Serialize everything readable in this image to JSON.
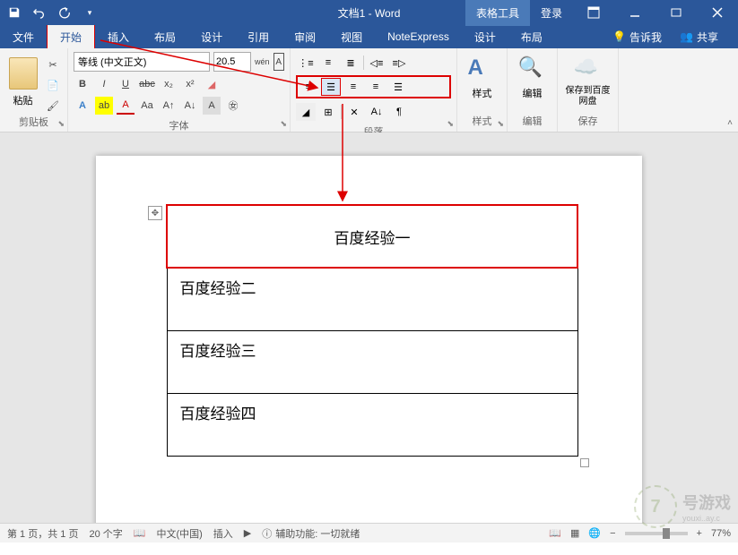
{
  "titlebar": {
    "document_title": "文档1 - Word",
    "table_tools": "表格工具",
    "login": "登录"
  },
  "tabs": {
    "file": "文件",
    "home": "开始",
    "insert": "插入",
    "layout": "布局",
    "design": "设计",
    "references": "引用",
    "review": "审阅",
    "view": "视图",
    "noteexpress": "NoteExpress",
    "table_design": "设计",
    "table_layout": "布局",
    "tell_me": "告诉我",
    "share": "共享"
  },
  "ribbon": {
    "clipboard": {
      "label": "剪贴板",
      "paste": "粘贴"
    },
    "font": {
      "label": "字体",
      "font_name": "等线 (中文正文)",
      "font_size": "20.5",
      "ruby": "wén"
    },
    "paragraph": {
      "label": "段落"
    },
    "styles": {
      "label": "样式",
      "button": "样式"
    },
    "editing": {
      "label": "编辑",
      "button": "编辑"
    },
    "save_cloud": {
      "label": "保存",
      "button": "保存到百度网盘"
    }
  },
  "document": {
    "cell1": "百度经验一",
    "cell2": "百度经验二",
    "cell3": "百度经验三",
    "cell4": "百度经验四"
  },
  "statusbar": {
    "page": "第 1 页，共 1 页",
    "words": "20 个字",
    "language": "中文(中国)",
    "mode": "插入",
    "accessibility": "辅助功能: 一切就绪",
    "zoom": "77%"
  },
  "watermark": {
    "text": "号游戏",
    "url": "youxi..ay.c"
  }
}
